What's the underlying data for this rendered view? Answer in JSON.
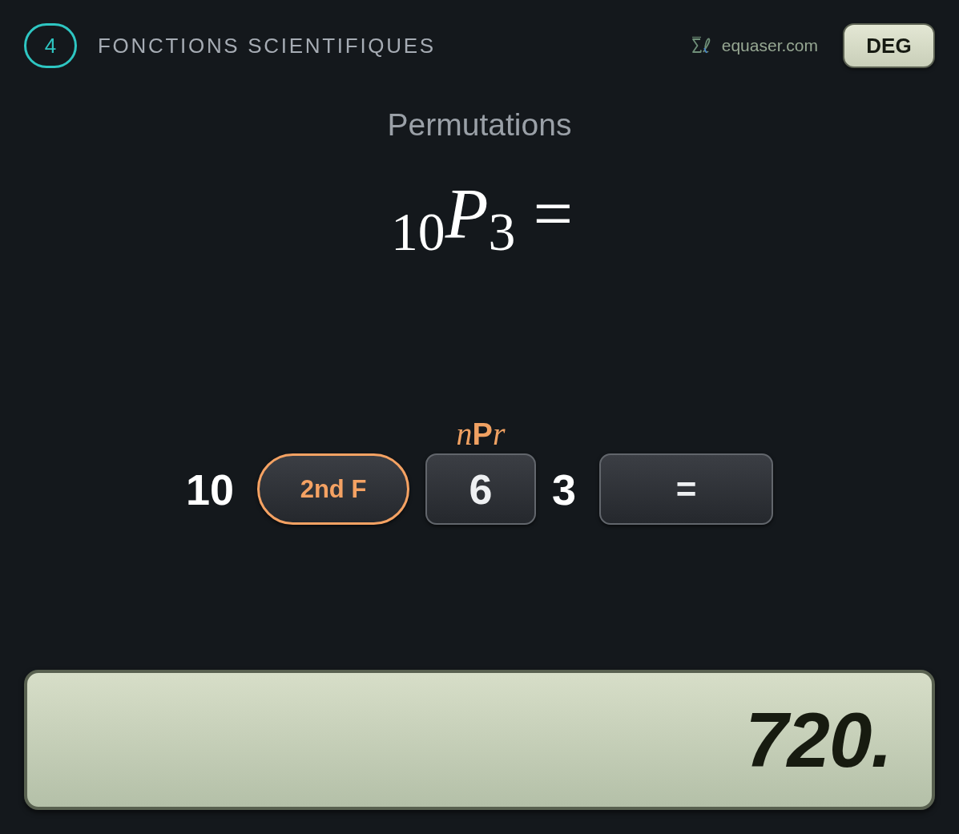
{
  "header": {
    "step": "4",
    "title": "FONCTIONS SCIENTIFIQUES",
    "site": "equaser.com",
    "angle_mode": "DEG"
  },
  "function_name": "Permutations",
  "formula": "$_{10}$*P*$_{3}$ =",
  "key_sequence": [
    {
      "kind": "number",
      "text": "10"
    },
    {
      "kind": "shift_key",
      "label": "2nd F"
    },
    {
      "kind": "key",
      "label": "6",
      "second_function": [
        {
          "text": "n",
          "italic": true
        },
        {
          "text": "P",
          "italic": false
        },
        {
          "text": "r",
          "italic": true
        }
      ]
    },
    {
      "kind": "number",
      "text": "3"
    },
    {
      "kind": "wide_key",
      "label": "="
    }
  ],
  "display": {
    "value": "720."
  }
}
